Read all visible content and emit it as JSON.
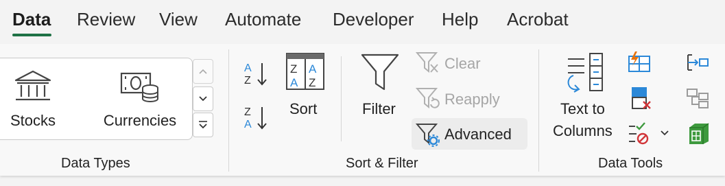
{
  "tabs": [
    "Data",
    "Review",
    "View",
    "Automate",
    "Developer",
    "Help",
    "Acrobat"
  ],
  "active_tab": "Data",
  "groups": {
    "data_types": {
      "label": "Data Types",
      "stocks_label": "Stocks",
      "currencies_label": "Currencies"
    },
    "sort_filter": {
      "label": "Sort & Filter",
      "sort_label": "Sort",
      "filter_label": "Filter",
      "clear_label": "Clear",
      "reapply_label": "Reapply",
      "advanced_label": "Advanced",
      "sort_az_letters": [
        "A",
        "Z"
      ],
      "sort_za_letters": [
        "Z",
        "A"
      ]
    },
    "data_tools": {
      "label": "Data Tools",
      "text_to_columns_line1": "Text to",
      "text_to_columns_line2": "Columns"
    }
  },
  "colors": {
    "accent_green": "#1e7145",
    "sort_blue": "#2b88d8",
    "flash_orange": "#e8730c",
    "error_red": "#d13438",
    "check_green": "#3e9a3e"
  },
  "icons": {
    "stocks": "bank-building-icon",
    "currencies": "money-coins-icon",
    "sort_az": "sort-ascending-icon",
    "sort_za": "sort-descending-icon",
    "sort": "sort-dialog-icon",
    "filter": "funnel-icon",
    "clear": "funnel-clear-icon",
    "reapply": "funnel-refresh-icon",
    "advanced": "funnel-gear-icon",
    "text_to_columns": "text-to-columns-icon",
    "flash_fill": "flash-fill-icon",
    "remove_duplicates": "remove-duplicates-icon",
    "data_validation": "data-validation-icon",
    "consolidate": "consolidate-icon",
    "relationships": "relationships-icon",
    "data_model": "data-model-icon"
  }
}
